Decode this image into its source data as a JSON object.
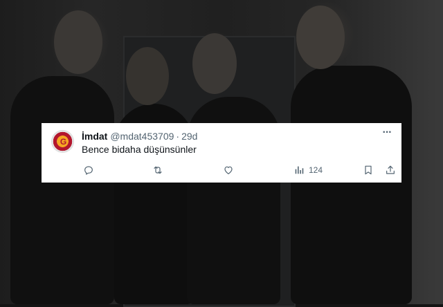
{
  "tweet": {
    "display_name": "İmdat",
    "handle": "@mdat453709",
    "separator": "·",
    "time": "29d",
    "text": "Bence bidaha düşünsünler",
    "more_icon": "more-horizontal-icon",
    "actions": {
      "reply_icon": "reply-icon",
      "retweet_icon": "retweet-icon",
      "like_icon": "heart-icon",
      "views_icon": "views-chart-icon",
      "views_count": "124",
      "bookmark_icon": "bookmark-icon",
      "share_icon": "share-icon"
    },
    "icon_color": "#536471"
  },
  "background": {
    "description_color": "#141414"
  }
}
